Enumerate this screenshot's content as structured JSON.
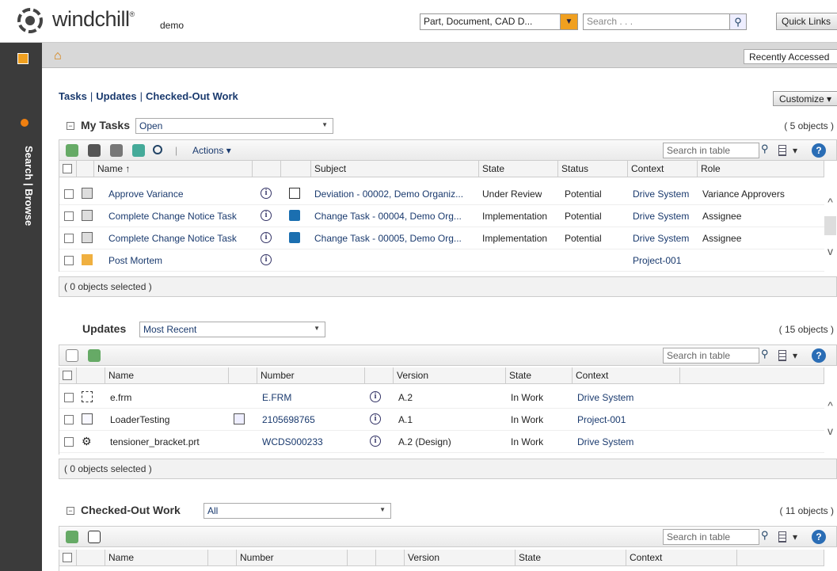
{
  "header": {
    "brand": "windchill",
    "brand_reg": "®",
    "site": "demo",
    "type_select": "Part, Document, CAD D...",
    "search_placeholder": "Search . . .",
    "quick_links": "Quick Links"
  },
  "graybar": {
    "recently_accessed": "Recently Accessed"
  },
  "leftnav": {
    "vertical_label": "Search | Browse"
  },
  "tabs": {
    "tasks": "Tasks",
    "updates": "Updates",
    "checked_out": "Checked-Out Work",
    "sep": "|"
  },
  "customize": "Customize",
  "my_tasks": {
    "title": "My Tasks",
    "filter": "Open",
    "count": "( 5 objects )",
    "actions": "Actions",
    "search_placeholder": "Search in table",
    "columns": [
      "Name",
      "Subject",
      "State",
      "Status",
      "Context",
      "Role"
    ],
    "name_sort": "↑",
    "rows": [
      {
        "name": "Approve Variance",
        "subject": "Deviation - 00002, Demo Organiz...",
        "state": "Under Review",
        "status": "Potential",
        "context": "Drive System",
        "role": "Variance Approvers"
      },
      {
        "name": "Complete Change Notice Task",
        "subject": "Change Task - 00004, Demo Org...",
        "state": "Implementation",
        "status": "Potential",
        "context": "Drive System",
        "role": "Assignee"
      },
      {
        "name": "Complete Change Notice Task",
        "subject": "Change Task - 00005, Demo Org...",
        "state": "Implementation",
        "status": "Potential",
        "context": "Drive System",
        "role": "Assignee"
      },
      {
        "name": "Post Mortem",
        "subject": "",
        "state": "",
        "status": "",
        "context": "Project-001",
        "role": ""
      }
    ],
    "selected": "( 0 objects selected )"
  },
  "updates": {
    "title": "Updates",
    "filter": "Most Recent",
    "count": "( 15 objects )",
    "search_placeholder": "Search in table",
    "columns": [
      "Name",
      "Number",
      "Version",
      "State",
      "Context"
    ],
    "rows": [
      {
        "name": "e.frm",
        "number": "E.FRM",
        "version": "A.2",
        "state": "In Work",
        "context": "Drive System"
      },
      {
        "name": "LoaderTesting",
        "number": "2105698765",
        "version": "A.1",
        "state": "In Work",
        "context": "Project-001"
      },
      {
        "name": "tensioner_bracket.prt",
        "number": "WCDS000233",
        "version": "A.2 (Design)",
        "state": "In Work",
        "context": "Drive System"
      }
    ],
    "selected": "( 0 objects selected )"
  },
  "checked_out": {
    "title": "Checked-Out Work",
    "filter": "All",
    "count": "( 11 objects )",
    "search_placeholder": "Search in table",
    "columns": [
      "Name",
      "Number",
      "Version",
      "State",
      "Context"
    ]
  },
  "colors": {
    "accent_orange": "#f0a020",
    "link_blue": "#1a3a6e",
    "nav_dark": "#3b3b3b"
  }
}
